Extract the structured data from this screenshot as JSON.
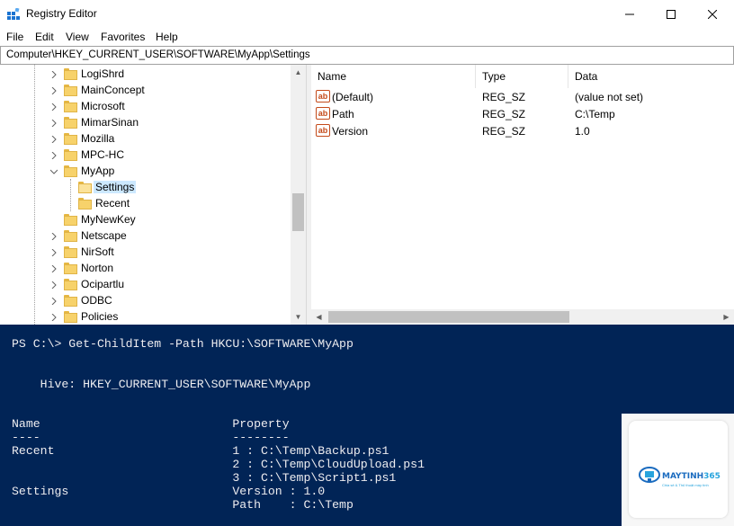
{
  "window": {
    "title": "Registry Editor",
    "controls": {
      "minimize": "minimize-icon",
      "maximize": "maximize-icon",
      "close": "close-icon"
    }
  },
  "menu": [
    "File",
    "Edit",
    "View",
    "Favorites",
    "Help"
  ],
  "address": "Computer\\HKEY_CURRENT_USER\\SOFTWARE\\MyApp\\Settings",
  "tree": {
    "items": [
      {
        "label": "LogiShrd",
        "level": 0,
        "expander": "collapsed"
      },
      {
        "label": "MainConcept",
        "level": 0,
        "expander": "collapsed"
      },
      {
        "label": "Microsoft",
        "level": 0,
        "expander": "collapsed"
      },
      {
        "label": "MimarSinan",
        "level": 0,
        "expander": "collapsed"
      },
      {
        "label": "Mozilla",
        "level": 0,
        "expander": "collapsed"
      },
      {
        "label": "MPC-HC",
        "level": 0,
        "expander": "collapsed"
      },
      {
        "label": "MyApp",
        "level": 0,
        "expander": "expanded"
      },
      {
        "label": "Settings",
        "level": 1,
        "expander": "none",
        "selected": true
      },
      {
        "label": "Recent",
        "level": 1,
        "expander": "none"
      },
      {
        "label": "MyNewKey",
        "level": 0,
        "expander": "none"
      },
      {
        "label": "Netscape",
        "level": 0,
        "expander": "collapsed"
      },
      {
        "label": "NirSoft",
        "level": 0,
        "expander": "collapsed"
      },
      {
        "label": "Norton",
        "level": 0,
        "expander": "collapsed"
      },
      {
        "label": "Ocipartlu",
        "level": 0,
        "expander": "collapsed"
      },
      {
        "label": "ODBC",
        "level": 0,
        "expander": "collapsed"
      },
      {
        "label": "Policies",
        "level": 0,
        "expander": "collapsed"
      }
    ]
  },
  "values": {
    "columns": [
      "Name",
      "Type",
      "Data"
    ],
    "rows": [
      {
        "name": "(Default)",
        "type": "REG_SZ",
        "data": "(value not set)"
      },
      {
        "name": "Path",
        "type": "REG_SZ",
        "data": "C:\\Temp"
      },
      {
        "name": "Version",
        "type": "REG_SZ",
        "data": "1.0"
      }
    ]
  },
  "console": {
    "lines": [
      "PS C:\\> Get-ChildItem -Path HKCU:\\SOFTWARE\\MyApp",
      "    Hive: HKEY_CURRENT_USER\\SOFTWARE\\MyApp",
      "Name                           Property",
      "----                           --------",
      "Recent                         1 : C:\\Temp\\Backup.ps1",
      "                               2 : C:\\Temp\\CloudUpload.ps1",
      "                               3 : C:\\Temp\\Script1.ps1",
      "Settings                       Version : 1.0",
      "                               Path    : C:\\Temp"
    ]
  },
  "logo": {
    "name_part1": "MAYTINH",
    "name_part2": "365",
    "tagline": "Chia sẻ & Thủ thuật máy tính"
  },
  "colors": {
    "console_bg": "#012456",
    "selection": "#cce8ff",
    "folder": "#f7d26b"
  }
}
